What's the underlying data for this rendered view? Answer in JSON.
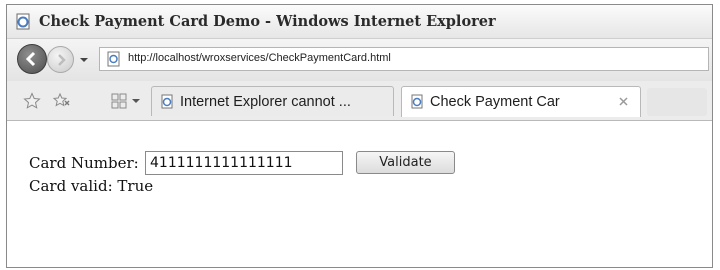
{
  "window": {
    "title": "Check Payment Card Demo - Windows Internet Explorer"
  },
  "addressbar": {
    "url": "http://localhost/wroxservices/CheckPaymentCard.html"
  },
  "tabs": [
    {
      "label": "Internet Explorer cannot ..."
    },
    {
      "label": "Check Payment Car"
    }
  ],
  "form": {
    "card_label": "Card Number:",
    "card_value": "4111111111111111",
    "validate_label": "Validate",
    "result_text": "Card valid: True"
  },
  "icons": {
    "title": "ie-page-icon",
    "back": "back-arrow-icon",
    "forward": "forward-arrow-icon",
    "favorites": "favorites-star-icon",
    "add_favorites": "add-favorites-icon",
    "quick_tabs": "quick-tabs-icon",
    "tab_close": "close-icon"
  }
}
